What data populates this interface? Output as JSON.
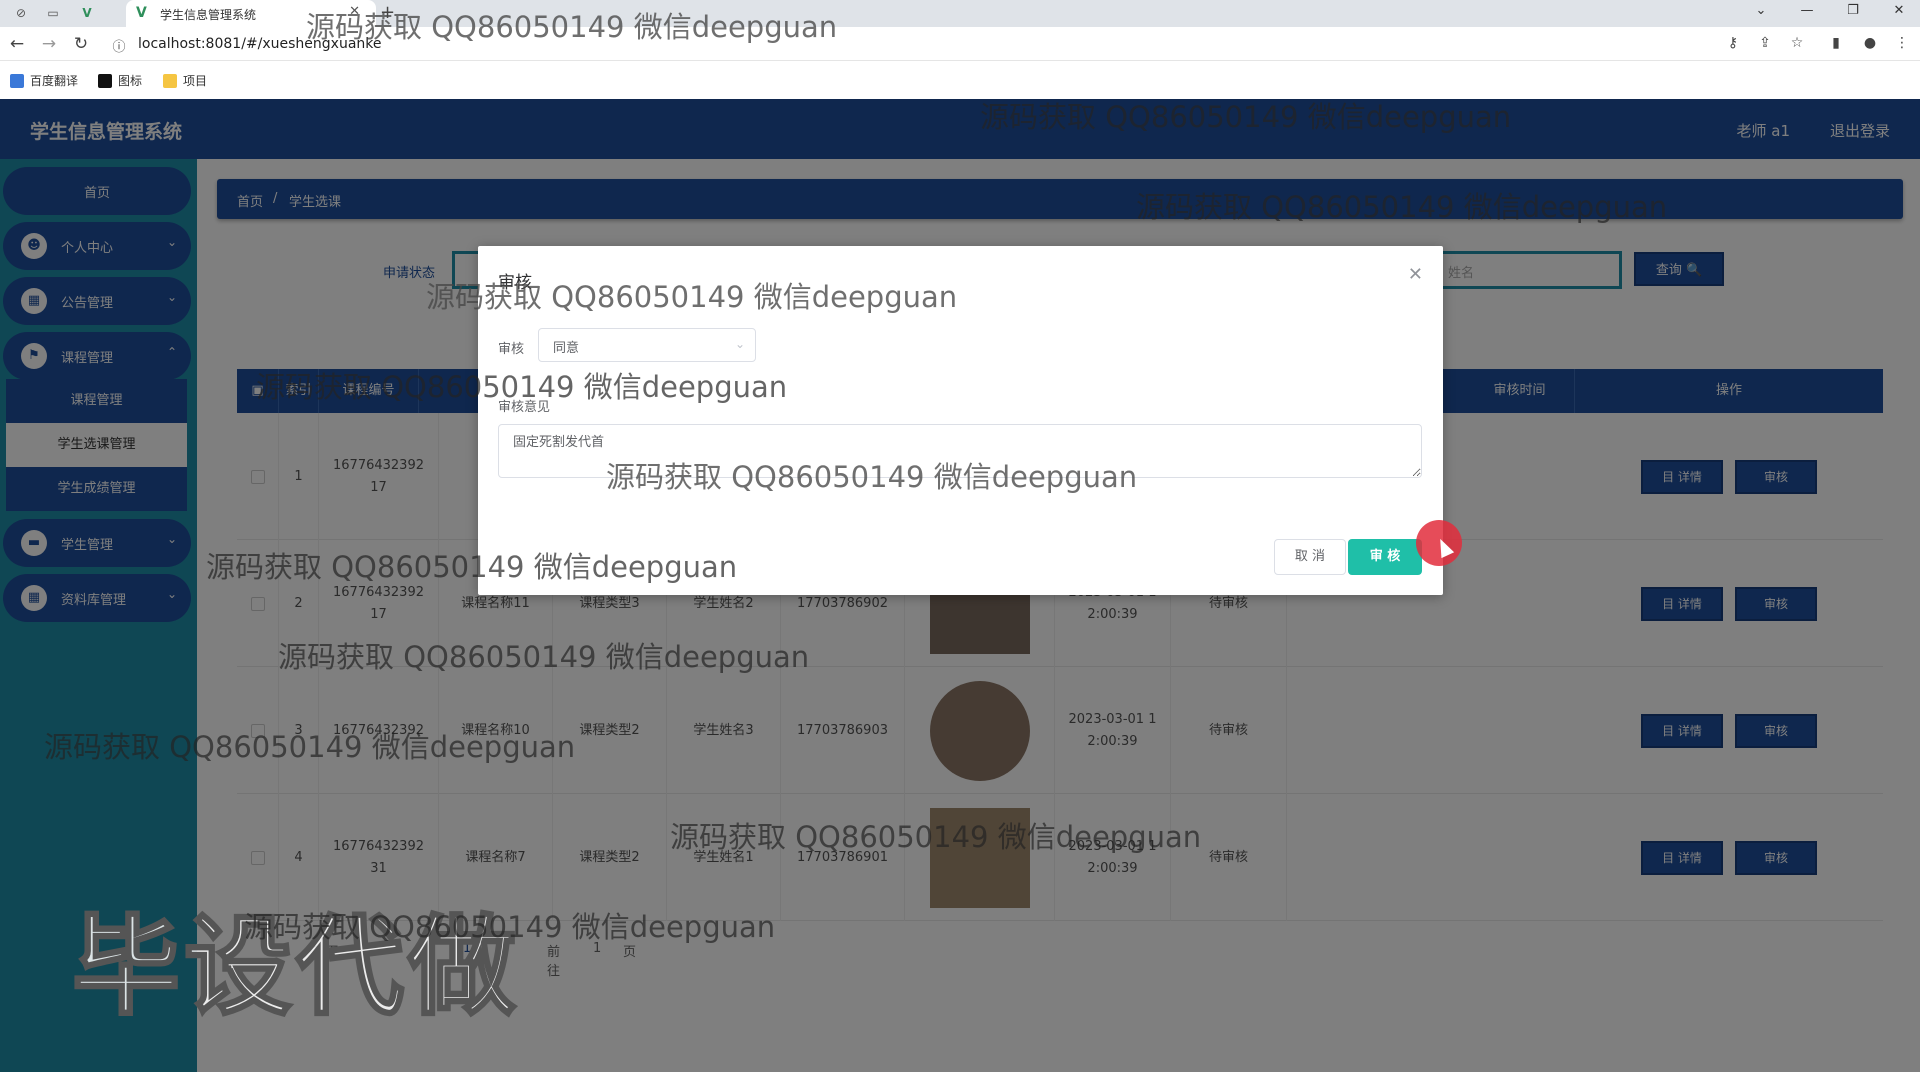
{
  "browser": {
    "tab_title": "学生信息管理系统",
    "url": "localhost:8081/#/xueshengxuanke",
    "bookmarks": [
      "百度翻译",
      "图标",
      "项目"
    ]
  },
  "app": {
    "title": "学生信息管理系统",
    "user": "老师 a1",
    "logout": "退出登录"
  },
  "sidebar": {
    "home": "首页",
    "items": [
      {
        "label": "个人中心",
        "icon": "user-icon"
      },
      {
        "label": "公告管理",
        "icon": "grid-icon"
      },
      {
        "label": "课程管理",
        "icon": "flag-icon"
      },
      {
        "label": "学生管理",
        "icon": "monitor-icon"
      },
      {
        "label": "资料库管理",
        "icon": "grid-icon"
      }
    ],
    "course_sub": [
      "课程管理",
      "学生选课管理",
      "学生成绩管理"
    ]
  },
  "breadcrumb": {
    "home": "首页",
    "sep": "/",
    "current": "学生选课"
  },
  "search": {
    "status_label": "申请状态",
    "name_placeholder": "姓名",
    "query_button": "查询 🔍"
  },
  "table": {
    "headers": [
      "索引",
      "课程编号",
      "审核时间",
      "操作"
    ],
    "rows": [
      {
        "index": "1",
        "code": "16776432392\n17",
        "name": "",
        "type": "",
        "student": "",
        "phone": "",
        "time": "",
        "status": ""
      },
      {
        "index": "2",
        "code": "16776432392\n17",
        "name": "课程名称11",
        "type": "课程类型3",
        "student": "学生姓名2",
        "phone": "17703786902",
        "time": "2023-03-01 1\n2:00:39",
        "status": "待审核"
      },
      {
        "index": "3",
        "code": "16776432392\n",
        "name": "课程名称10",
        "type": "课程类型2",
        "student": "学生姓名3",
        "phone": "17703786903",
        "time": "2023-03-01 1\n2:00:39",
        "status": "待审核"
      },
      {
        "index": "4",
        "code": "16776432392\n31",
        "name": "课程名称7",
        "type": "课程类型2",
        "student": "学生姓名1",
        "phone": "17703786901",
        "time": "2023-03-01 1\n2:00:39",
        "status": "待审核"
      }
    ],
    "detail_button": "目 详情",
    "audit_button": "审核"
  },
  "pager": {
    "page_size": "1 页",
    "current": "1",
    "goto_label": "前往",
    "goto_value": "1",
    "goto_suffix": "页"
  },
  "dialog": {
    "title": "审核",
    "audit_label": "审核",
    "audit_value": "同意",
    "opinion_label": "审核意见",
    "opinion_value": "固定死割发代首",
    "cancel": "取 消",
    "confirm": "审 核"
  },
  "watermark_text": "源码获取 QQ86050149 微信deepguan",
  "big_watermark": "毕设代做",
  "colors": {
    "primary": "#1e4e9c",
    "sidebar": "#1f8fa8",
    "confirm": "#1fbfa8",
    "cursor": "#e22d3c"
  }
}
